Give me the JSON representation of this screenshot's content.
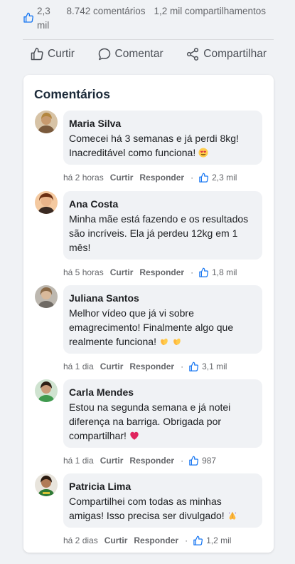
{
  "stats": {
    "likes": "2,3 mil",
    "comments": "8.742 comentários",
    "shares": "1,2 mil compartilhamentos"
  },
  "actions": {
    "like": "Curtir",
    "comment": "Comentar",
    "share": "Compartilhar"
  },
  "comments_section": {
    "title": "Comentários",
    "items": [
      {
        "author": "Maria Silva",
        "text": "Comecei há 3 semanas e já perdi 8kg! Inacreditável como funciona!",
        "emoji": "heart-eyes-emoji",
        "time": "há 2 horas",
        "like_label": "Curtir",
        "reply_label": "Responder",
        "likes": "2,3 mil",
        "avatar_color": "#c79a6e"
      },
      {
        "author": "Ana Costa",
        "text": "Minha mãe está fazendo e os resultados são incríveis. Ela já perdeu 12kg em 1 mês!",
        "emoji": "",
        "time": "há 5 horas",
        "like_label": "Curtir",
        "reply_label": "Responder",
        "likes": "1,8 mil",
        "avatar_color": "#a0572f"
      },
      {
        "author": "Juliana Santos",
        "text": "Melhor vídeo que já vi sobre emagrecimento! Finalmente algo que realmente funciona!",
        "emoji": "clapping-hands-emoji",
        "time": "há 1 dia",
        "like_label": "Curtir",
        "reply_label": "Responder",
        "likes": "3,1 mil",
        "avatar_color": "#8c8a86"
      },
      {
        "author": "Carla Mendes",
        "text": "Estou na segunda semana e já notei diferença na barriga. Obrigada por compartilhar!",
        "emoji": "red-heart-emoji",
        "time": "há 1 dia",
        "like_label": "Curtir",
        "reply_label": "Responder",
        "likes": "987",
        "avatar_color": "#4f8a55"
      },
      {
        "author": "Patricia Lima",
        "text": "Compartilhei com todas as minhas amigas! Isso precisa ser divulgado!",
        "emoji": "praying-hands-emoji",
        "time": "há 2 dias",
        "like_label": "Curtir",
        "reply_label": "Responder",
        "likes": "1,2 mil",
        "avatar_color": "#3e7a3a"
      }
    ]
  },
  "colors": {
    "accent": "#1877f2",
    "bubble": "#f0f2f5",
    "muted_text": "#65676b"
  }
}
